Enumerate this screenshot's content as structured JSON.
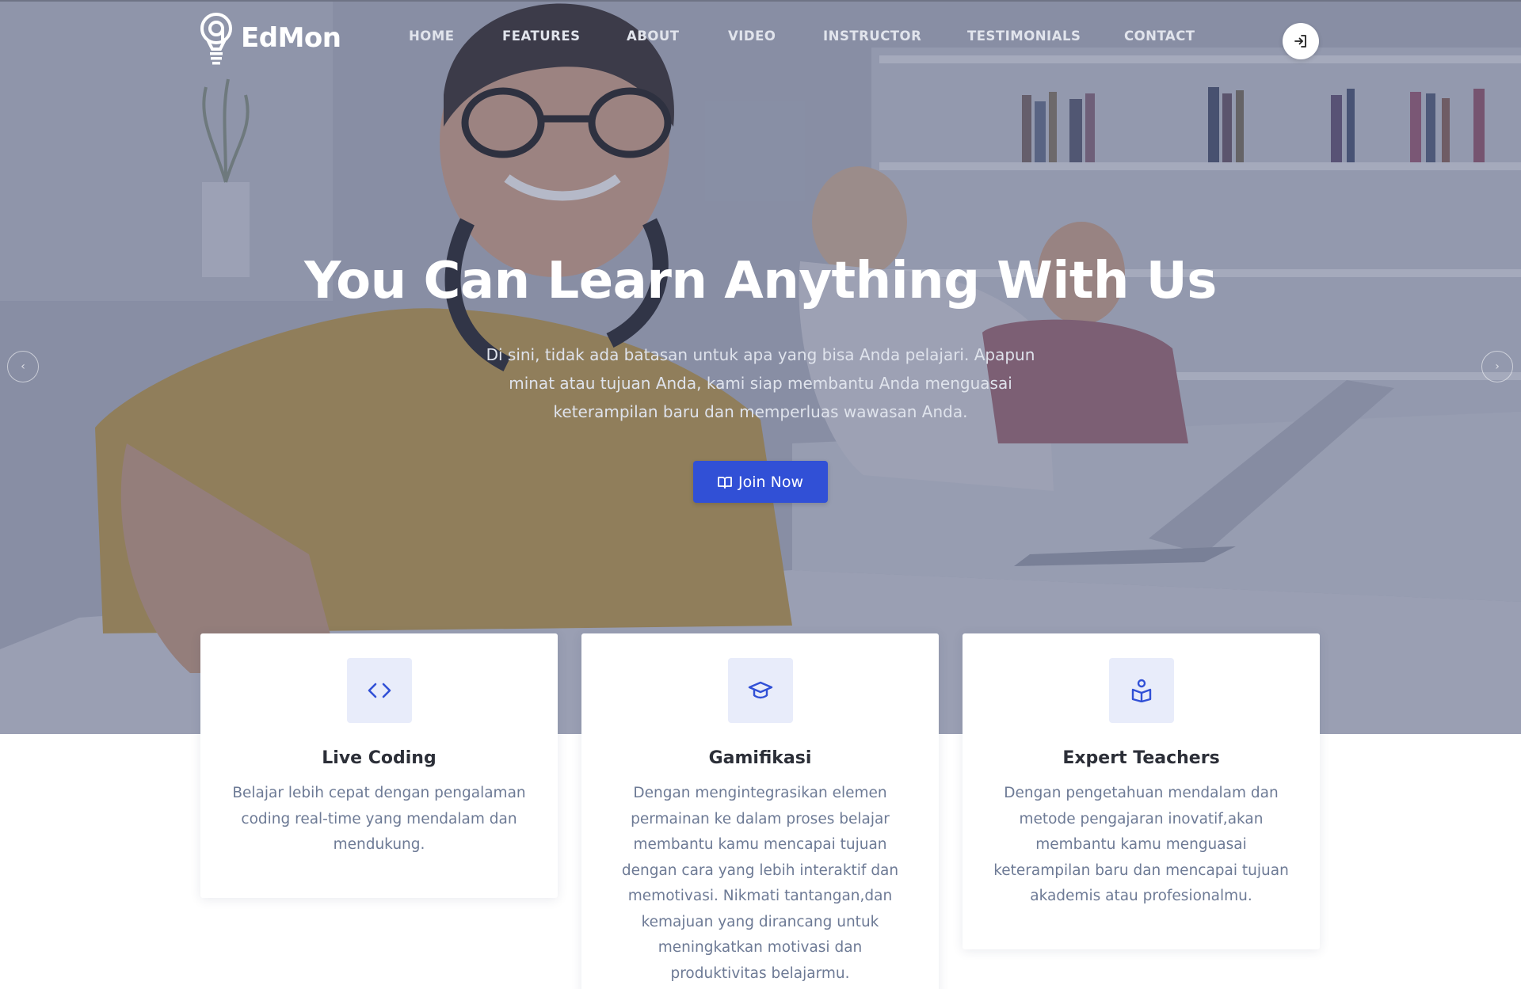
{
  "brand": {
    "name": "EdMon",
    "icon": "lightbulb-icon"
  },
  "nav": {
    "items": [
      {
        "label": "HOME"
      },
      {
        "label": "FEATURES"
      },
      {
        "label": "ABOUT"
      },
      {
        "label": "VIDEO"
      },
      {
        "label": "INSTRUCTOR"
      },
      {
        "label": "TESTIMONIALS"
      },
      {
        "label": "CONTACT"
      }
    ],
    "login_icon": "sign-in-icon"
  },
  "hero": {
    "title": "You Can Learn Anything With Us",
    "description": "Di sini, tidak ada batasan untuk apa yang bisa Anda pelajari. Apapun minat atau tujuan Anda, kami siap membantu Anda menguasai keterampilan baru dan memperluas wawasan Anda.",
    "cta_label": "Join Now",
    "cta_icon": "book-icon",
    "prev_icon": "chevron-left-icon",
    "next_icon": "chevron-right-icon"
  },
  "features": [
    {
      "title": "Live Coding",
      "text": "Belajar lebih cepat dengan pengalaman coding real-time yang mendalam dan mendukung.",
      "icon": "code-icon"
    },
    {
      "title": "Gamifikasi",
      "text": "Dengan mengintegrasikan elemen permainan ke dalam proses belajar membantu kamu mencapai tujuan dengan cara yang lebih interaktif dan memotivasi. Nikmati tantangan,dan kemajuan yang dirancang untuk meningkatkan motivasi dan produktivitas belajarmu.",
      "icon": "graduation-cap-icon"
    },
    {
      "title": "Expert Teachers",
      "text": "Dengan pengetahuan mendalam dan metode pengajaran inovatif,akan membantu kamu menguasai keterampilan baru dan mencapai tujuan akademis atau profesionalmu.",
      "icon": "teacher-icon"
    }
  ],
  "colors": {
    "accent": "#3150d6",
    "icon_bg": "#e8ecfa",
    "card_text": "#6d7a95",
    "card_title": "#2c2f38"
  }
}
